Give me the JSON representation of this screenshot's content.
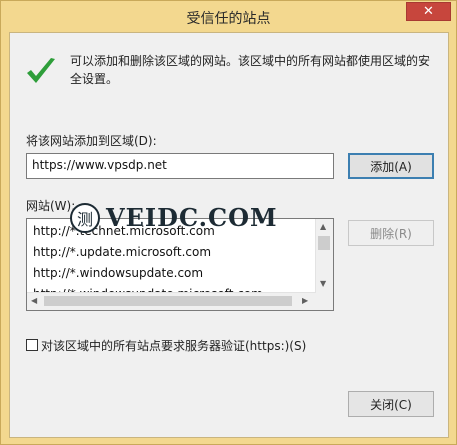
{
  "window": {
    "title": "受信任的站点",
    "close_symbol": "✕"
  },
  "description": "可以添加和删除该区域的网站。该区域中的所有网站都使用区域的安全设置。",
  "add_section": {
    "label": "将该网站添加到区域(D):",
    "input_value": "https://www.vpsdp.net",
    "add_button": "添加(A)"
  },
  "sites_section": {
    "label": "网站(W):",
    "items": [
      "http://*.technet.microsoft.com",
      "http://*.update.microsoft.com",
      "http://*.windowsupdate.com",
      "http://*.windowsupdate.microsoft.com"
    ],
    "remove_button": "删除(R)"
  },
  "https_checkbox": {
    "label": "对该区域中的所有站点要求服务器验证(https:)(S)",
    "checked": false
  },
  "close_button": "关闭(C)",
  "watermark": {
    "logo_glyph": "测",
    "text": "VEIDC.COM"
  },
  "colors": {
    "title_bg": "#f3d88f",
    "close_red": "#c7463d",
    "check_green": "#2e9e3a",
    "default_border": "#3c7fb1"
  }
}
